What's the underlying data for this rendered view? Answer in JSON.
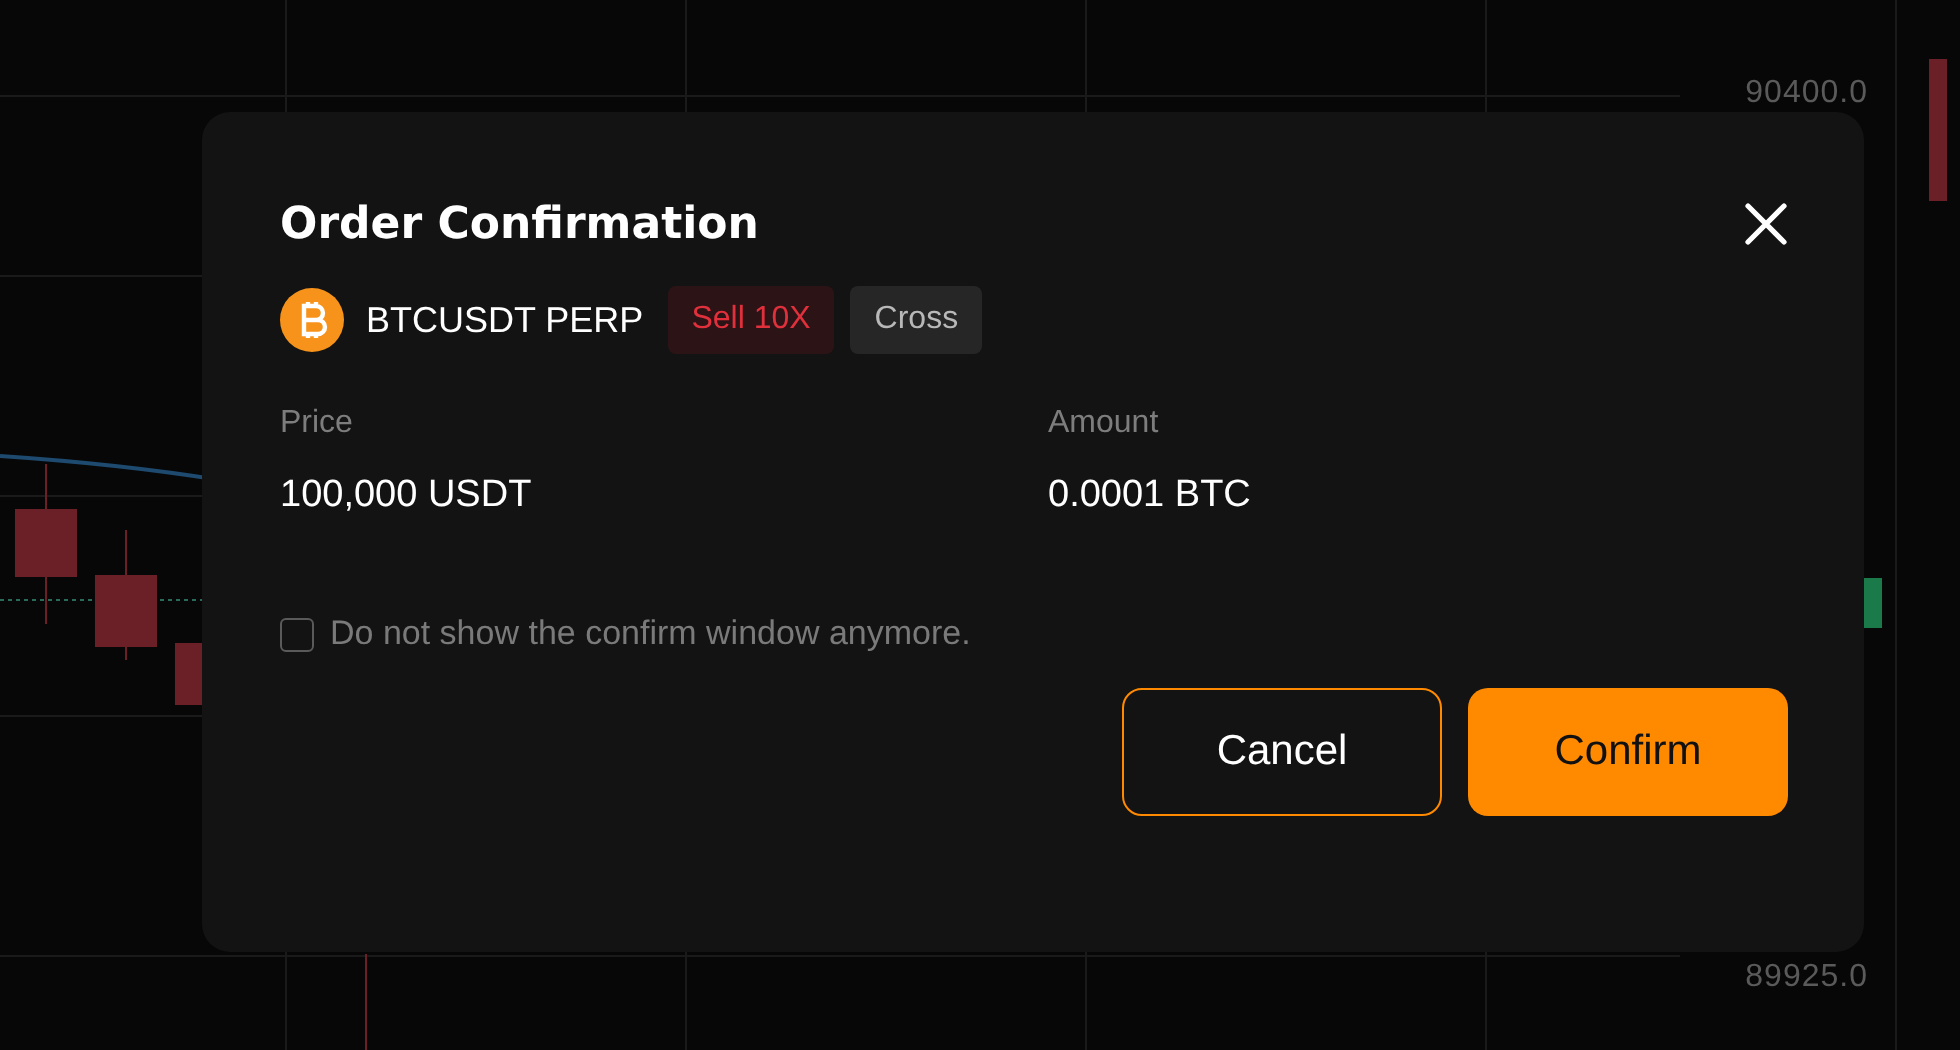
{
  "chart": {
    "price_labels": [
      "90400.0",
      "89925.0"
    ]
  },
  "dialog": {
    "title": "Order Confirmation",
    "symbol": "BTCUSDT PERP",
    "side_tag": {
      "label": "Sell 10X",
      "kind": "sell"
    },
    "margin_tag": "Cross",
    "fields": [
      {
        "label": "Price",
        "value": "100,000 USDT"
      },
      {
        "label": "Amount",
        "value": "0.0001 BTC"
      }
    ],
    "dont_show_again": {
      "label": "Do not show the confirm window anymore.",
      "checked": false
    },
    "buttons": [
      {
        "label": "Cancel",
        "kind": "secondary"
      },
      {
        "label": "Confirm",
        "kind": "primary"
      }
    ]
  }
}
